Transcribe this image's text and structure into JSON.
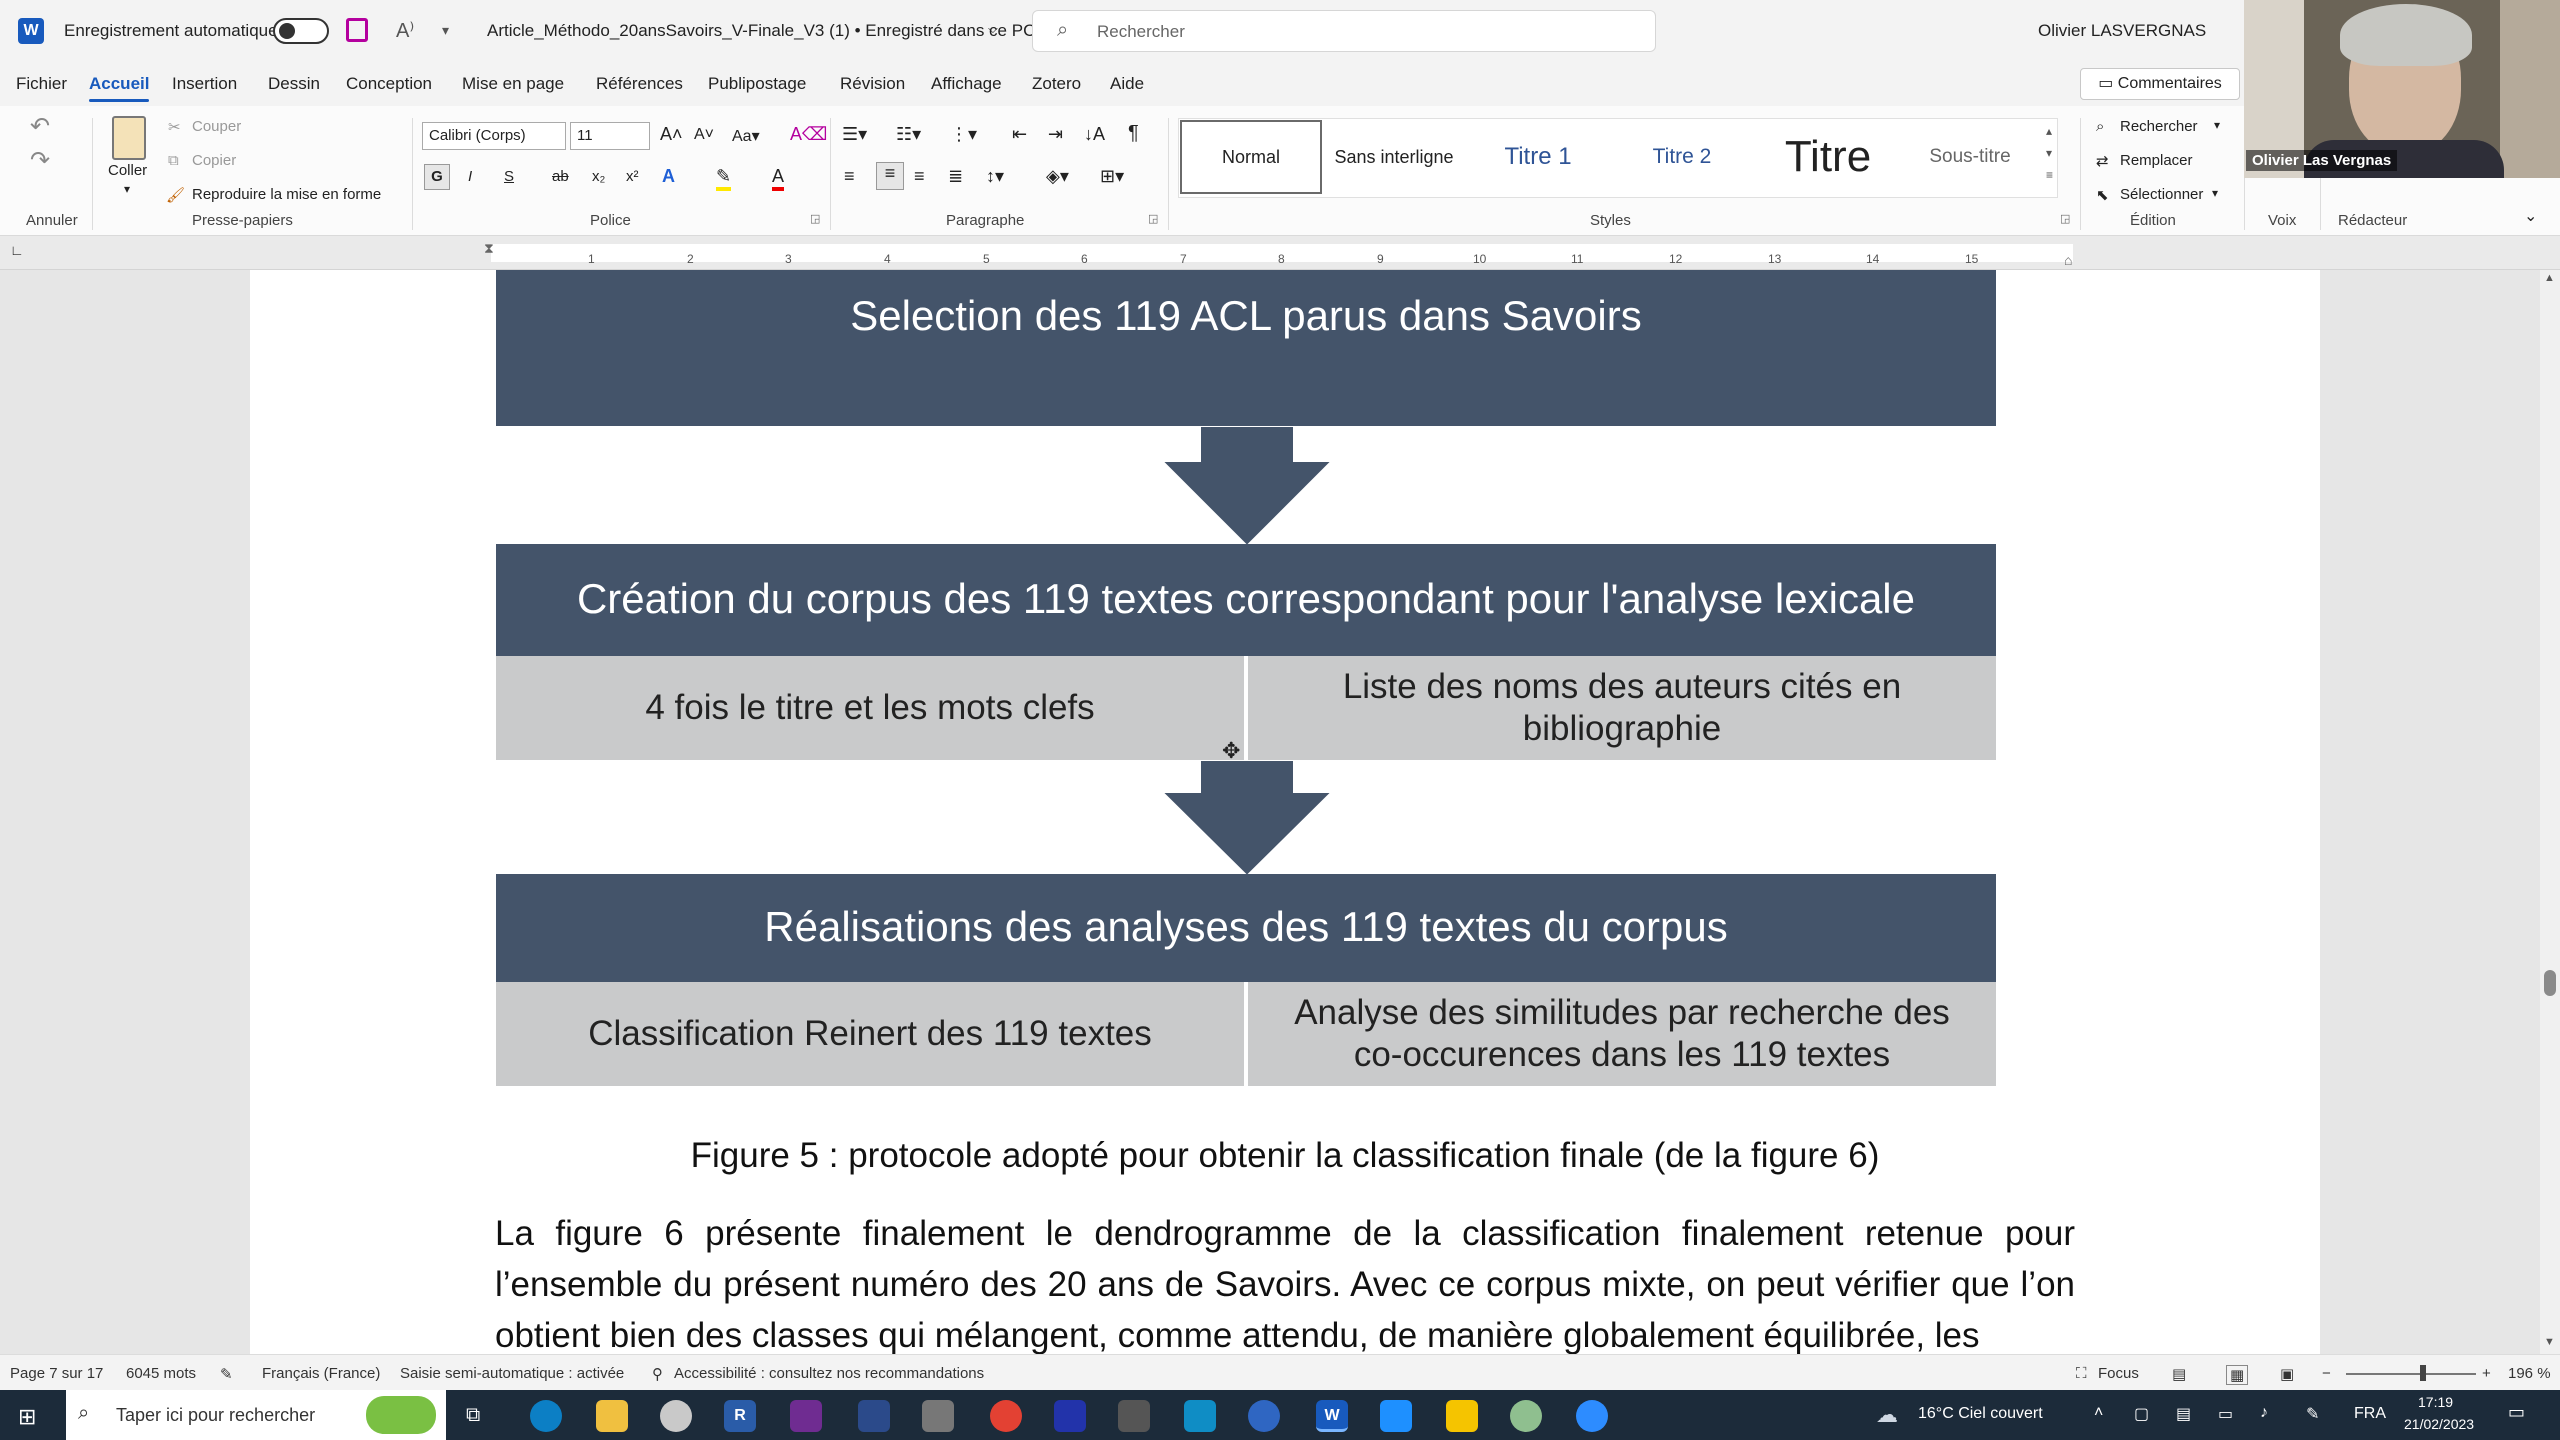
{
  "titlebar": {
    "autosave_label": "Enregistrement automatique",
    "doc_title": "Article_Méthodo_20ansSavoirs_V-Finale_V3 (1) • Enregistré dans ce PC",
    "search_placeholder": "Rechercher",
    "user_name": "Olivier LASVERGNAS"
  },
  "menu": {
    "items": [
      "Fichier",
      "Accueil",
      "Insertion",
      "Dessin",
      "Conception",
      "Mise en page",
      "Références",
      "Publipostage",
      "Révision",
      "Affichage",
      "Zotero",
      "Aide"
    ],
    "comments_label": "Commentaires"
  },
  "ribbon": {
    "clipboard": {
      "paste": "Coller",
      "cut": "Couper",
      "copy": "Copier",
      "format_painter": "Reproduire la mise en forme",
      "group": "Presse-papiers",
      "undo_group": "Annuler"
    },
    "font": {
      "family": "Calibri (Corps)",
      "size": "11",
      "group": "Police",
      "bold": "G",
      "italic": "I",
      "underline": "S"
    },
    "paragraph": {
      "group": "Paragraphe"
    },
    "styles": {
      "items": [
        "Normal",
        "Sans interligne",
        "Titre 1",
        "Titre 2",
        "Titre",
        "Sous-titre"
      ],
      "group": "Styles"
    },
    "editing": {
      "find": "Rechercher",
      "replace": "Remplacer",
      "select": "Sélectionner",
      "group": "Édition"
    },
    "voice_group": "Voix",
    "editor_group": "Rédacteur"
  },
  "ruler_numbers": [
    "1",
    "2",
    "3",
    "4",
    "5",
    "6",
    "7",
    "8",
    "9",
    "10",
    "11",
    "12",
    "13",
    "14",
    "15"
  ],
  "diagram": {
    "step1": "Selection des 119 ACL parus dans Savoirs",
    "step2": "Création du corpus des 119 textes correspondant pour l'analyse lexicale",
    "step2_left": "4 fois le titre et les mots clefs",
    "step2_right": "Liste des noms des auteurs cités en bibliographie",
    "step3": "Réalisations des analyses des 119 textes du corpus",
    "step3_left": "Classification Reinert des 119 textes",
    "step3_right": "Analyse des similitudes par recherche des co-occurences dans les 119 textes",
    "box_color": "#44546a",
    "sub_color": "#c9cacb"
  },
  "document": {
    "caption": "Figure 5 : protocole adopté pour obtenir la classification finale (de la figure 6)",
    "paragraph": "La figure 6 présente finalement le dendrogramme de la classification finalement retenue pour l’ensemble du présent numéro des 20 ans de Savoirs. Avec ce corpus mixte, on peut vérifier que l’on obtient bien des classes qui mélangent, comme attendu, de manière globalement équilibrée, les"
  },
  "statusbar": {
    "page": "Page 7 sur 17",
    "words": "6045 mots",
    "language": "Français (France)",
    "autocomplete": "Saisie semi-automatique : activée",
    "accessibility": "Accessibilité : consultez nos recommandations",
    "focus": "Focus",
    "zoom": "196 %"
  },
  "taskbar": {
    "search_placeholder": "Taper ici pour rechercher",
    "weather": "16°C  Ciel couvert",
    "lang": "FRA",
    "time": "17:19",
    "date": "21/02/2023"
  },
  "webcam": {
    "label": "Olivier Las Vergnas"
  }
}
